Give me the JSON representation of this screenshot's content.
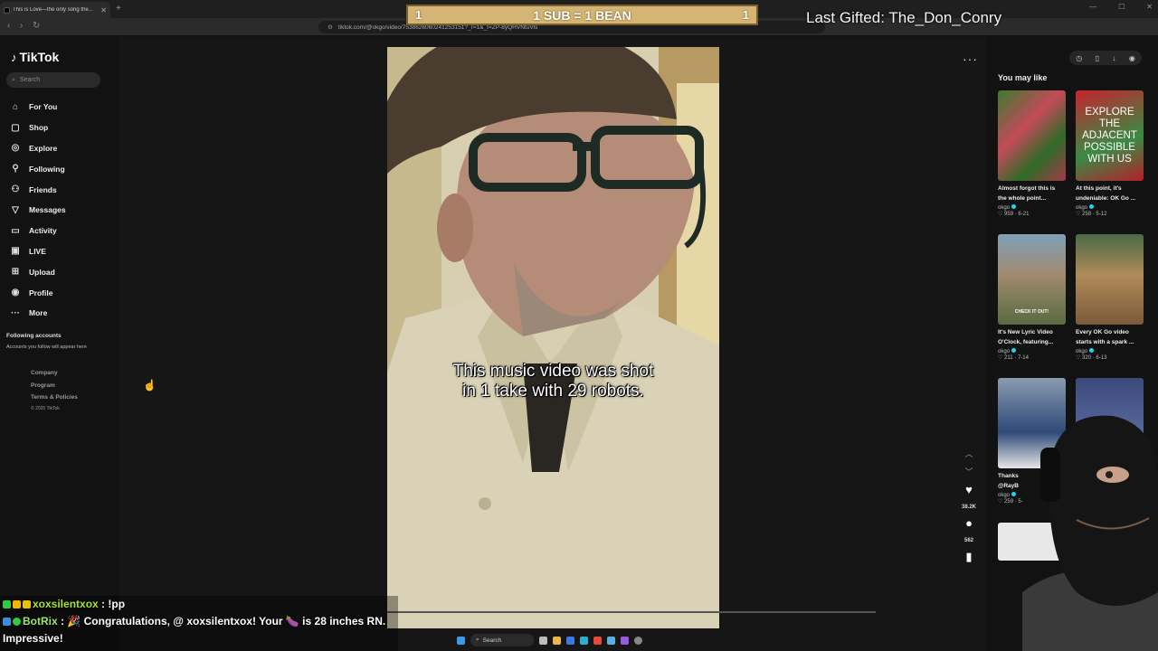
{
  "browser": {
    "tab_title": "This is Love—the only song the...",
    "url": "tiktok.com/@okgo/video/7538626060241253151?_r=1&_t=ZP-8yQHVNtuVls"
  },
  "overlay": {
    "sub_left": "1",
    "sub_text": "1 SUB = 1 BEAN",
    "sub_right": "1",
    "last_gifted": "Last Gifted: The_Don_Conry"
  },
  "sidebar": {
    "logo": "TikTok",
    "search_placeholder": "Search",
    "items": [
      {
        "label": "For You",
        "icon": "home-icon"
      },
      {
        "label": "Shop",
        "icon": "shop-icon"
      },
      {
        "label": "Explore",
        "icon": "compass-icon"
      },
      {
        "label": "Following",
        "icon": "following-icon"
      },
      {
        "label": "Friends",
        "icon": "friends-icon"
      },
      {
        "label": "Messages",
        "icon": "messages-icon"
      },
      {
        "label": "Activity",
        "icon": "activity-icon"
      },
      {
        "label": "LIVE",
        "icon": "live-icon"
      },
      {
        "label": "Upload",
        "icon": "upload-icon"
      },
      {
        "label": "Profile",
        "icon": "profile-icon"
      },
      {
        "label": "More",
        "icon": "more-icon"
      }
    ],
    "following_heading": "Following accounts",
    "following_sub": "Accounts you follow will appear here",
    "footer": [
      "Company",
      "Program",
      "Terms & Policies"
    ],
    "copyright": "© 2025 TikTok"
  },
  "video": {
    "caption_line1": "This music video was shot",
    "caption_line2": "in 1 take with 29 robots.",
    "likes": "38.2K",
    "comments": "562"
  },
  "right_panel": {
    "heading": "You may like",
    "cards": [
      {
        "title": "Almost forgot this is",
        "title2": "the whole point...",
        "author": "okgo",
        "likes": "959",
        "date": "6-21",
        "thumb_text": ""
      },
      {
        "title": "At this point, it's",
        "title2": "undeniable: OK Go ...",
        "author": "okgo",
        "likes": "258",
        "date": "5-12",
        "thumb_text": "EXPLORE THE ADJACENT POSSIBLE WITH US"
      },
      {
        "title": "It's New Lyric Video",
        "title2": "O'Clock, featuring...",
        "author": "okgo",
        "likes": "211",
        "date": "7-14",
        "thumb_text": "CHECK IT OUT!"
      },
      {
        "title": "Every OK Go video",
        "title2": "starts with a spark ...",
        "author": "okgo",
        "likes": "320",
        "date": "6-13",
        "thumb_text": ""
      },
      {
        "title": "Thanks",
        "title2": "@RayB",
        "author": "okgo",
        "likes": "259",
        "date": "5-",
        "thumb_text": ""
      }
    ]
  },
  "chat": [
    {
      "user": "xoxsilentxox",
      "sep": " : ",
      "msg": "!pp"
    },
    {
      "user": "BotRix",
      "sep": " : ",
      "msg": "🎉 Congratulations, @ xoxsilentxox! Your 🍆 is 28 inches RN."
    },
    {
      "user": "",
      "sep": "",
      "msg": "Impressive!"
    }
  ],
  "taskbar": {
    "search": "Search"
  }
}
